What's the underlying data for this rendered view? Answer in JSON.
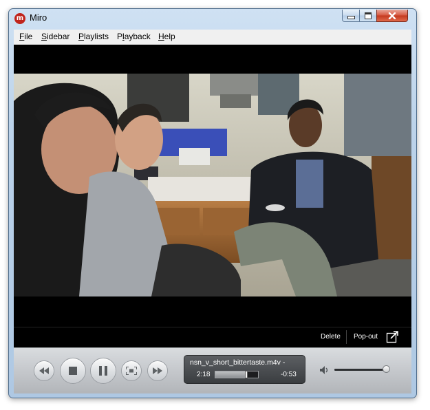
{
  "window": {
    "title": "Miro",
    "app_icon_letter": "m"
  },
  "menu": [
    {
      "label": "File",
      "mnemonic": "F",
      "rest": "ile"
    },
    {
      "label": "Sidebar",
      "mnemonic": "S",
      "rest": "idebar"
    },
    {
      "label": "Playlists",
      "mnemonic": "P",
      "rest": "laylists"
    },
    {
      "label": "Playback",
      "pre": "P",
      "mnemonic": "l",
      "rest": "ayback"
    },
    {
      "label": "Help",
      "mnemonic": "H",
      "rest": "elp"
    }
  ],
  "video_controls": {
    "delete_label": "Delete",
    "popout_label": "Pop-out"
  },
  "player": {
    "filename": "nsn_v_short_bittertaste.m4v -",
    "elapsed": "2:18",
    "remaining": "-0:53",
    "progress_fraction": 0.72,
    "volume_fraction": 0.95
  },
  "icons": {
    "back": "rewind-icon",
    "stop": "stop-icon",
    "pause": "pause-icon",
    "fullscreen": "fullscreen-icon",
    "forward": "fast-forward-icon",
    "volume": "volume-icon",
    "popout": "popout-arrow-icon"
  }
}
